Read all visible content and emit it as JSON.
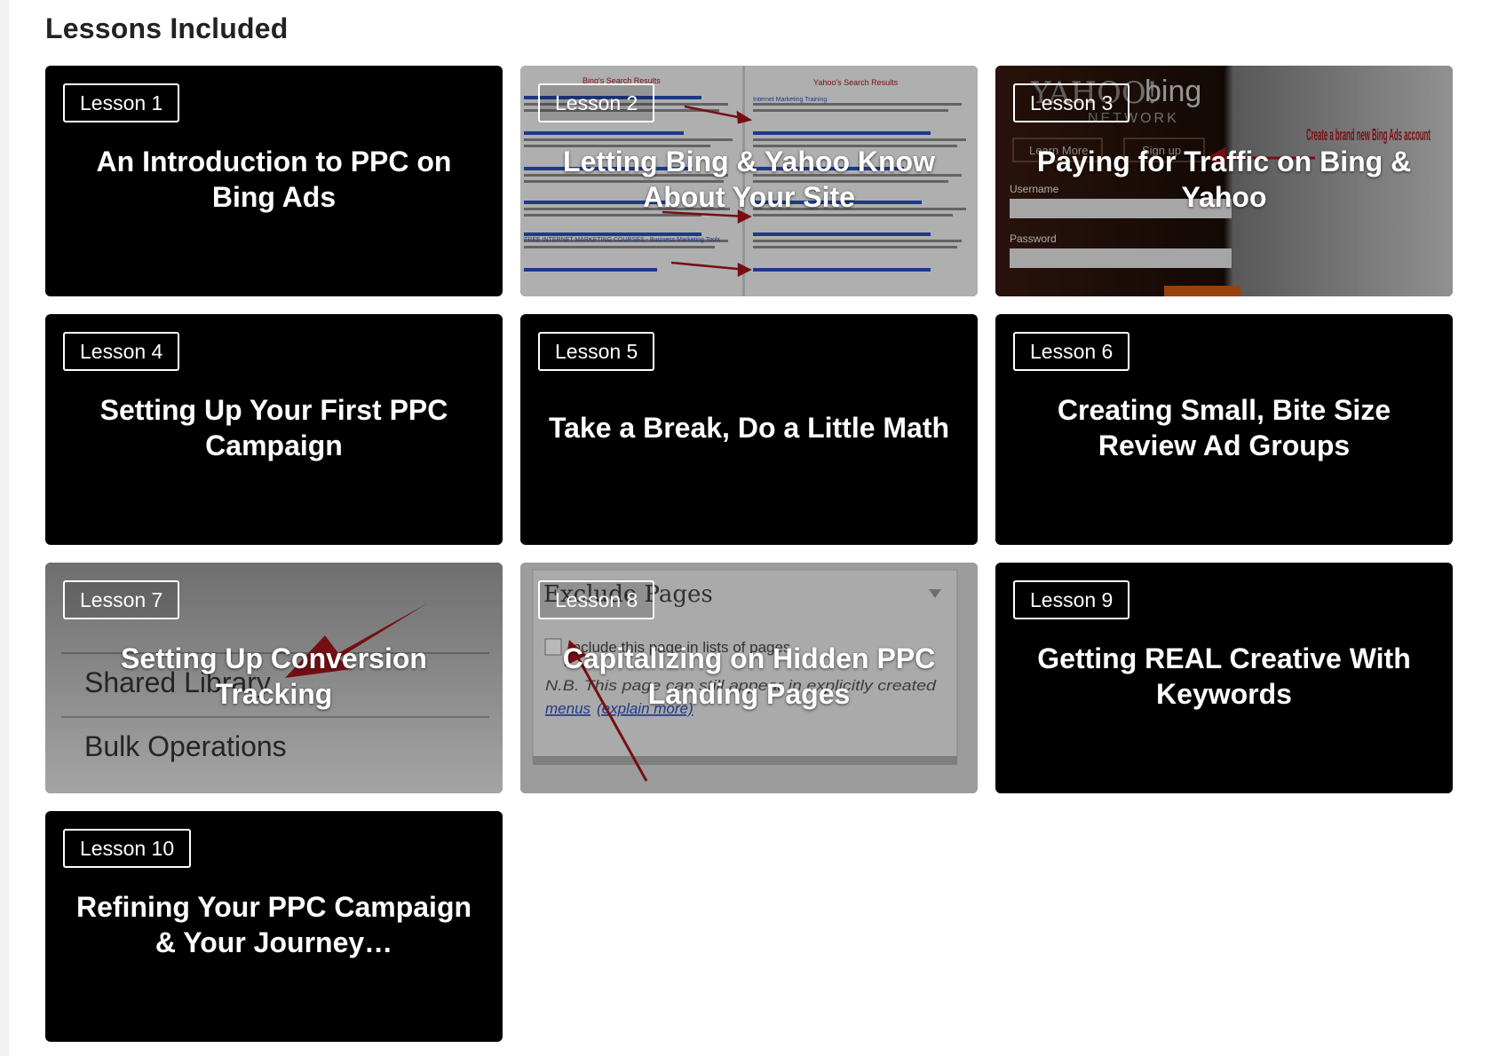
{
  "section_title": "Lessons Included",
  "lessons": [
    {
      "label": "Lesson 1",
      "title": "An Introduction to PPC on Bing Ads"
    },
    {
      "label": "Lesson 2",
      "title": "Letting Bing & Yahoo Know About Your Site",
      "thumb": {
        "left_heading": "Bing's Search Results",
        "right_heading": "Yahoo's Search Results",
        "result_title": "Internet Marketing Training",
        "result_link": "FREE INTERNET MARKETING COURSES - Business Marketing Tools"
      }
    },
    {
      "label": "Lesson 3",
      "title": "Paying for Traffic on Bing & Yahoo",
      "thumb": {
        "logo_yahoo": "YAHOO!",
        "logo_bing": "bing",
        "network": "NETWORK",
        "learn_more": "Learn More",
        "sign_up": "Sign up",
        "username": "Username",
        "password": "Password",
        "callout": "Create a brand new Bing Ads account"
      }
    },
    {
      "label": "Lesson 4",
      "title": "Setting Up Your First PPC Campaign"
    },
    {
      "label": "Lesson 5",
      "title": "Take a Break, Do a Little Math"
    },
    {
      "label": "Lesson 6",
      "title": "Creating Small, Bite Size Review Ad Groups"
    },
    {
      "label": "Lesson 7",
      "title": "Setting Up Conversion Tracking",
      "thumb": {
        "menu_item_1": "Shared Library",
        "menu_item_2": "Bulk Operations"
      }
    },
    {
      "label": "Lesson 8",
      "title": "Capitalizing on Hidden PPC Landing Pages",
      "thumb": {
        "panel_title": "Exclude Pages",
        "checkbox_label": "Include this page in lists of pages",
        "note": "N.B. This page can still appear in explicitly created",
        "link_menus": "menus",
        "link_explain": "(explain more)"
      }
    },
    {
      "label": "Lesson 9",
      "title": "Getting REAL Creative With Keywords"
    },
    {
      "label": "Lesson 10",
      "title": "Refining Your PPC Campaign & Your Journey…"
    }
  ],
  "colors": {
    "card_bg": "#000000",
    "accent_arrow": "#a3161c",
    "text": "#ffffff"
  }
}
